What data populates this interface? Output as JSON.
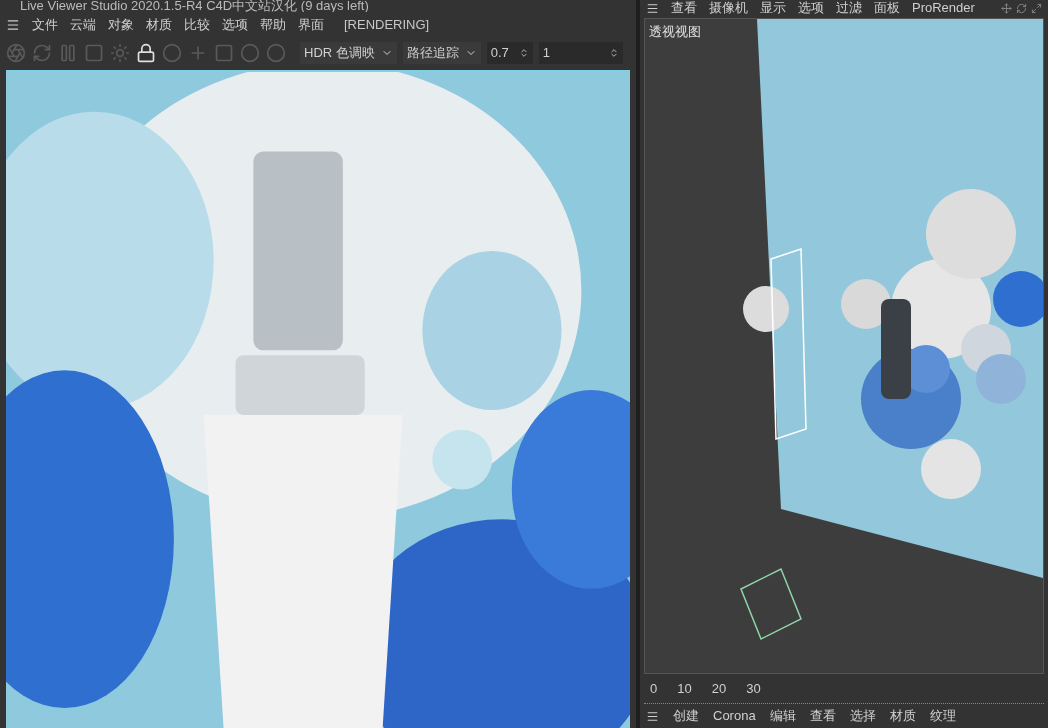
{
  "live_viewer": {
    "title": "Live Viewer Studio 2020.1.5-R4 C4D中文站汉化 (9 days left)",
    "menu": [
      "文件",
      "云端",
      "对象",
      "材质",
      "比较",
      "选项",
      "帮助",
      "界面"
    ],
    "status": "[RENDERING]",
    "toolbar": {
      "tone_mapping": "HDR 色调映",
      "kernel": "路径追踪",
      "value_1": "0.7",
      "value_2": "1"
    }
  },
  "viewport_panel": {
    "menu": [
      "查看",
      "摄像机",
      "显示",
      "选项",
      "过滤",
      "面板",
      "ProRender"
    ],
    "view_label": "透视视图",
    "timeline_ticks": [
      "0",
      "10",
      "20",
      "30"
    ]
  },
  "bottom_menu": [
    "创建",
    "Corona",
    "编辑",
    "查看",
    "选择",
    "材质",
    "纹理"
  ]
}
